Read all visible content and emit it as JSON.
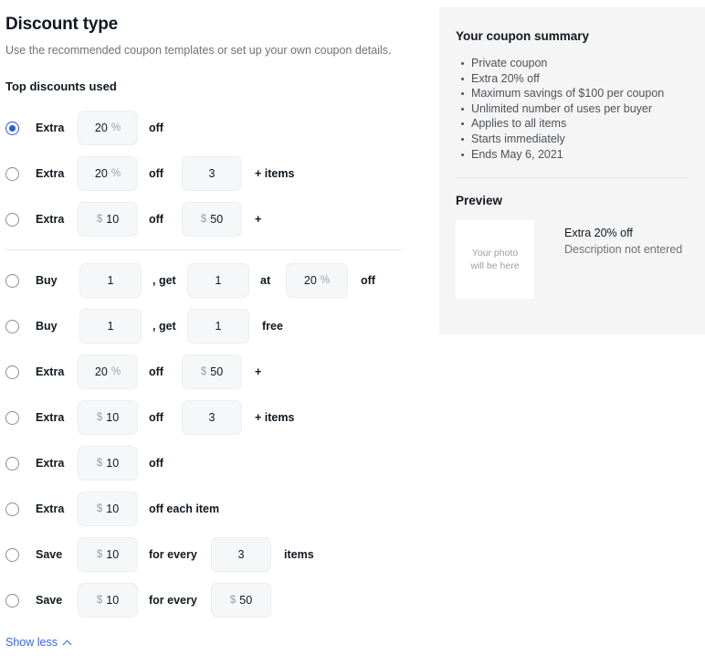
{
  "page": {
    "title": "Discount type",
    "subtitle": "Use the recommended coupon templates or set up your own coupon details.",
    "section_label": "Top discounts used",
    "show_less_label": "Show less",
    "accent_color": "#3665f3",
    "selected_radio_color": "#2b5bd7"
  },
  "options": [
    {
      "id": "extra-percent-off",
      "selected": true,
      "verb": "Extra",
      "field1": {
        "prefix": "",
        "value": "20",
        "unit": "%"
      },
      "connector1": "off",
      "field2": null,
      "tail": ""
    },
    {
      "id": "extra-percent-off-min-items",
      "selected": false,
      "verb": "Extra",
      "field1": {
        "prefix": "",
        "value": "20",
        "unit": "%"
      },
      "connector1": "off",
      "field2": {
        "prefix": "",
        "value": "3",
        "unit": ""
      },
      "tail": "+ items"
    },
    {
      "id": "extra-amount-off-min-spend",
      "selected": false,
      "verb": "Extra",
      "field1": {
        "prefix": "$",
        "value": "10",
        "unit": ""
      },
      "connector1": "off",
      "field2": {
        "prefix": "$",
        "value": "50",
        "unit": ""
      },
      "tail": "+"
    },
    {
      "id": "buy-x-get-y-at-percent-off",
      "selected": false,
      "verb": "Buy",
      "field1": {
        "prefix": "",
        "value": "1",
        "unit": ""
      },
      "connector1": ", get",
      "field2": {
        "prefix": "",
        "value": "1",
        "unit": ""
      },
      "connector2": "at",
      "field3": {
        "prefix": "",
        "value": "20",
        "unit": "%"
      },
      "tail": "off"
    },
    {
      "id": "buy-x-get-y-free",
      "selected": false,
      "verb": "Buy",
      "field1": {
        "prefix": "",
        "value": "1",
        "unit": ""
      },
      "connector1": ", get",
      "field2": {
        "prefix": "",
        "value": "1",
        "unit": ""
      },
      "tail": "free"
    },
    {
      "id": "extra-percent-off-min-spend",
      "selected": false,
      "verb": "Extra",
      "field1": {
        "prefix": "",
        "value": "20",
        "unit": "%"
      },
      "connector1": "off",
      "field2": {
        "prefix": "$",
        "value": "50",
        "unit": ""
      },
      "tail": "+"
    },
    {
      "id": "extra-amount-off-min-items",
      "selected": false,
      "verb": "Extra",
      "field1": {
        "prefix": "$",
        "value": "10",
        "unit": ""
      },
      "connector1": "off",
      "field2": {
        "prefix": "",
        "value": "3",
        "unit": ""
      },
      "tail": "+ items"
    },
    {
      "id": "extra-amount-off",
      "selected": false,
      "verb": "Extra",
      "field1": {
        "prefix": "$",
        "value": "10",
        "unit": ""
      },
      "connector1": "off",
      "field2": null,
      "tail": ""
    },
    {
      "id": "extra-amount-off-each-item",
      "selected": false,
      "verb": "Extra",
      "field1": {
        "prefix": "$",
        "value": "10",
        "unit": ""
      },
      "connector1": "off each item",
      "field2": null,
      "tail": ""
    },
    {
      "id": "save-amount-for-every-items",
      "selected": false,
      "verb": "Save",
      "field1": {
        "prefix": "$",
        "value": "10",
        "unit": ""
      },
      "connector1": "for every",
      "field2": {
        "prefix": "",
        "value": "3",
        "unit": ""
      },
      "tail": "items"
    },
    {
      "id": "save-amount-for-every-spend",
      "selected": false,
      "verb": "Save",
      "field1": {
        "prefix": "$",
        "value": "10",
        "unit": ""
      },
      "connector1": "for every",
      "field2": {
        "prefix": "$",
        "value": "50",
        "unit": ""
      },
      "tail": ""
    }
  ],
  "summary": {
    "title": "Your coupon summary",
    "items": [
      "Private coupon",
      "Extra 20% off",
      "Maximum savings of $100 per coupon",
      "Unlimited number of uses per buyer",
      "Applies to all items",
      "Starts immediately",
      "Ends May 6, 2021"
    ]
  },
  "preview": {
    "title": "Preview",
    "photo_placeholder_line1": "Your photo",
    "photo_placeholder_line2": "will be here",
    "headline": "Extra 20% off",
    "description": "Description not entered"
  }
}
